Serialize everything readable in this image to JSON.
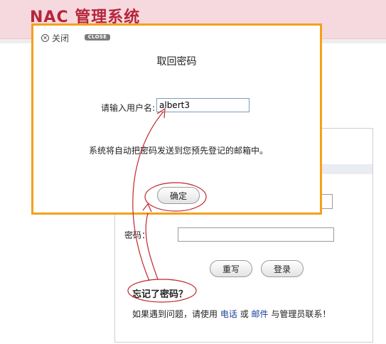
{
  "header": {
    "brand": "NAC 管理系统"
  },
  "login": {
    "password_label": "密码：",
    "reset_label": "重写",
    "login_label": "登录",
    "forgot_label": "忘记了密码？",
    "contact_prefix": "如果遇到问题，请使用",
    "contact_phone": "电话",
    "contact_or": "或",
    "contact_mail": "邮件",
    "contact_suffix": "与管理员联系！"
  },
  "dialog": {
    "close_label": "关闭",
    "close_badge": "CLOSE",
    "title": "取回密码",
    "field_label": "请输入用户名:",
    "username_value": "albert3",
    "notice": "系统将自动把密码发送到您预先登记的邮箱中。",
    "confirm_label": "确定"
  },
  "colors": {
    "dialog_border": "#f5a01a",
    "brand": "#b5253b",
    "annotation": "#c0262c"
  }
}
